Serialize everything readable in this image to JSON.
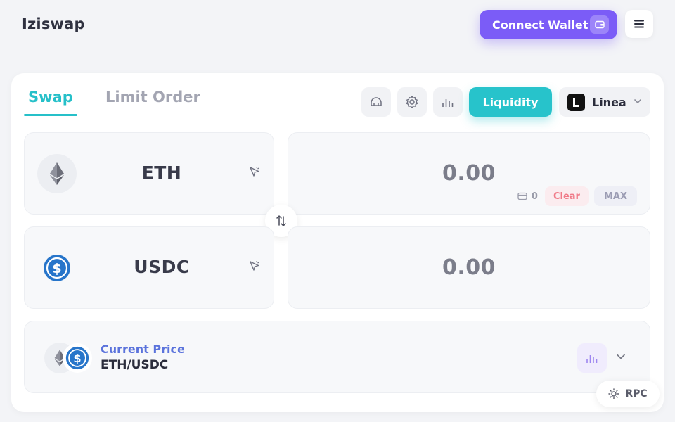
{
  "header": {
    "logo": "Iziswap",
    "connect_wallet_label": "Connect Wallet"
  },
  "tabs": [
    {
      "label": "Swap",
      "active": true
    },
    {
      "label": "Limit Order",
      "active": false
    }
  ],
  "toolbar": {
    "icons": [
      "dashboard-icon",
      "gear-icon",
      "bar-chart-icon"
    ],
    "liquidity_label": "Liquidity",
    "network": "Linea"
  },
  "swap": {
    "from": {
      "token": "ETH",
      "amount": "0.00",
      "balance": "0",
      "clear_label": "Clear",
      "max_label": "MAX"
    },
    "to": {
      "token": "USDC",
      "amount": "0.00"
    }
  },
  "price": {
    "label": "Current Price",
    "pair": "ETH/USDC"
  },
  "rpc_label": "RPC",
  "colors": {
    "accent_teal": "#27c3cb",
    "accent_purple": "#7b5cf7",
    "usdc_blue": "#2775ca",
    "clear_red": "#f07a88"
  }
}
